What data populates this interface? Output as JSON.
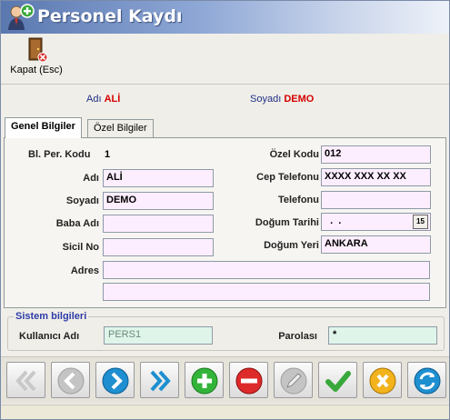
{
  "window": {
    "title": "Personel Kaydı"
  },
  "toolbar": {
    "close_label": "Kapat (Esc)"
  },
  "header": {
    "first_name_label": "Adı",
    "first_name_value": "ALİ",
    "last_name_label": "Soyadı",
    "last_name_value": "DEMO"
  },
  "tabs": [
    {
      "label": "Genel Bilgiler",
      "active": true
    },
    {
      "label": "Özel Bilgiler",
      "active": false
    }
  ],
  "form": {
    "code_label": "Bl. Per. Kodu",
    "code_value": "1",
    "first_name_label": "Adı",
    "first_name_value": "ALİ",
    "last_name_label": "Soyadı",
    "last_name_value": "DEMO",
    "father_name_label": "Baba Adı",
    "father_name_value": "",
    "registry_label": "Sicil No",
    "registry_value": "",
    "address_label": "Adres",
    "address_line1": "",
    "address_line2": "",
    "special_code_label": "Özel Kodu",
    "special_code_value": "012",
    "mobile_label": "Cep Telefonu",
    "mobile_value": "XXXX XXX XX XX",
    "phone_label": "Telefonu",
    "phone_value": "",
    "birth_date_label": "Doğum Tarihi",
    "birth_date_value": "  .  .",
    "birth_date_button": "15",
    "birth_place_label": "Doğum Yeri",
    "birth_place_value": "ANKARA"
  },
  "system": {
    "group_title": "Sistem bilgileri",
    "username_label": "Kullanıcı Adı",
    "username_value": "PERS1",
    "password_label": "Parolası",
    "password_value": "*"
  },
  "nav_buttons": [
    {
      "name": "first-record-button",
      "icon": "double-chevron-left-icon",
      "enabled": false
    },
    {
      "name": "previous-record-button",
      "icon": "chevron-left-icon",
      "enabled": false
    },
    {
      "name": "next-record-button",
      "icon": "chevron-right-icon",
      "enabled": true
    },
    {
      "name": "last-record-button",
      "icon": "double-chevron-right-icon",
      "enabled": true
    },
    {
      "name": "add-record-button",
      "icon": "plus-icon",
      "enabled": true
    },
    {
      "name": "delete-record-button",
      "icon": "minus-icon",
      "enabled": true
    },
    {
      "name": "edit-record-button",
      "icon": "pencil-icon",
      "enabled": false
    },
    {
      "name": "save-record-button",
      "icon": "checkmark-icon",
      "enabled": true
    },
    {
      "name": "cancel-record-button",
      "icon": "cancel-x-icon",
      "enabled": true
    },
    {
      "name": "refresh-button",
      "icon": "refresh-icon",
      "enabled": true
    }
  ],
  "colors": {
    "input_background": "#fdeeff",
    "system_input_background": "#dff5ea",
    "header_label": "#1f2f86",
    "header_value": "#d40000",
    "title_gradient_start": "#5a78b0"
  }
}
